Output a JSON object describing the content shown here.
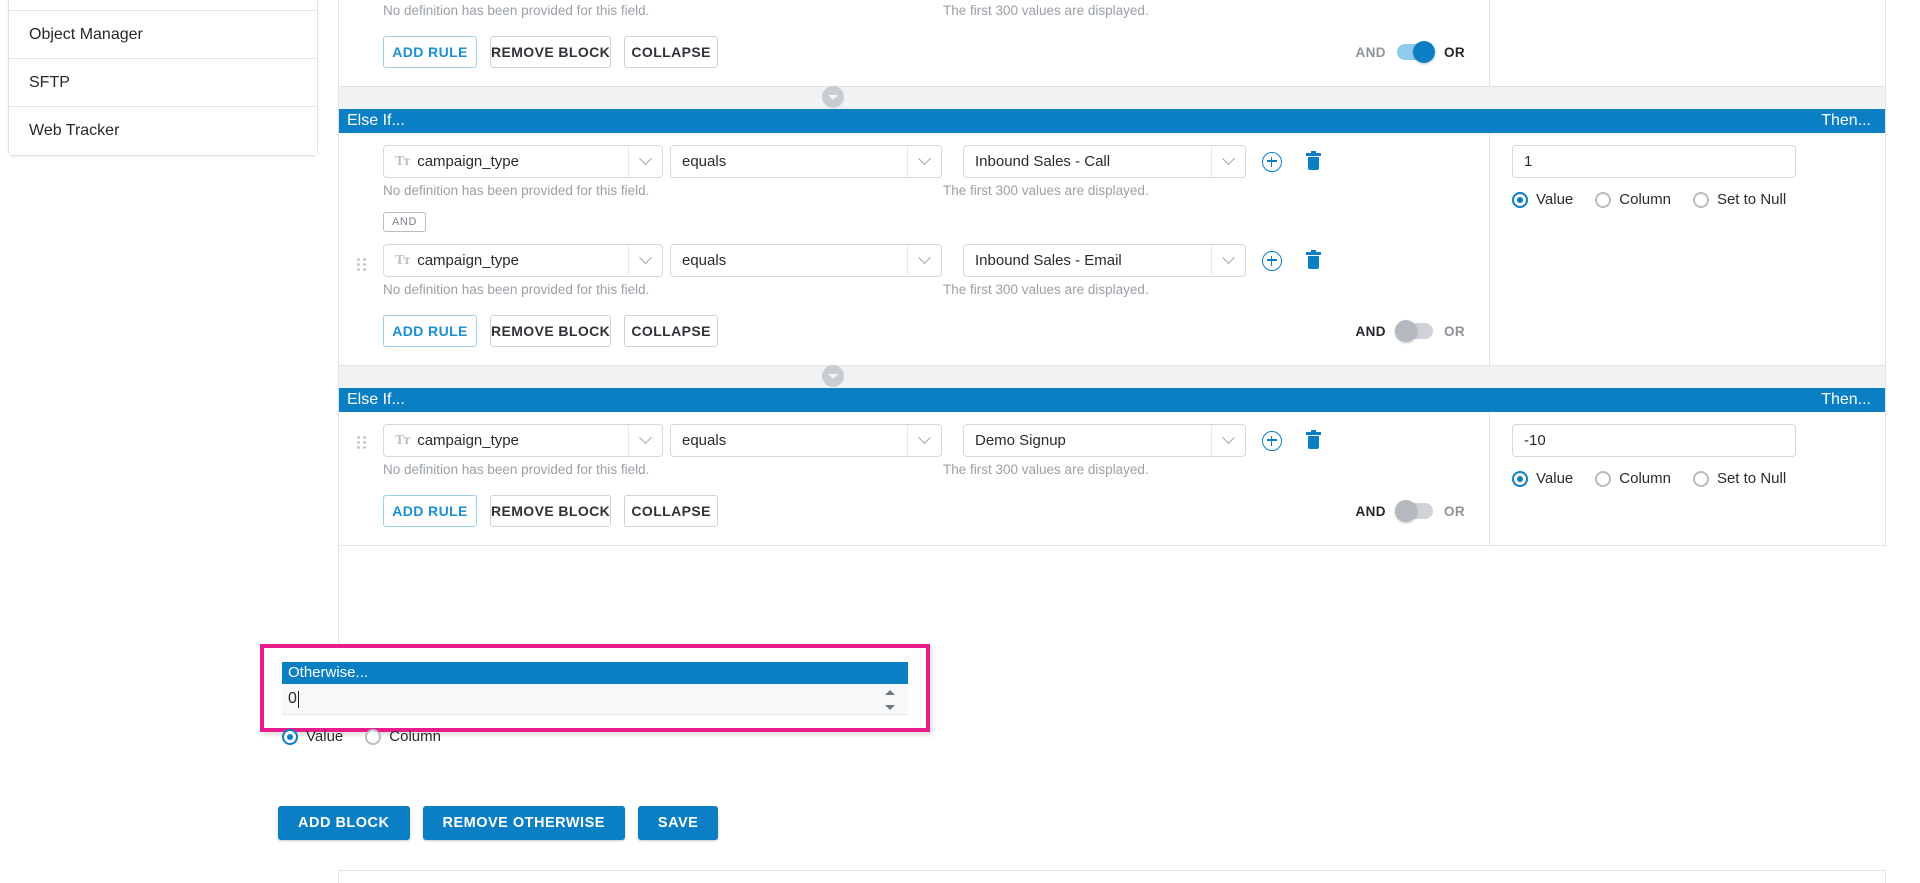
{
  "sidebar": {
    "items": [
      {
        "label": "Object Manager",
        "name": "sidebar-item-object-manager"
      },
      {
        "label": "SFTP",
        "name": "sidebar-item-sftp"
      },
      {
        "label": "Web Tracker",
        "name": "sidebar-item-web-tracker"
      }
    ]
  },
  "colors": {
    "accent": "#0b7fc4",
    "highlight": "#ec1b8b",
    "toggle_on": "#8ecbec",
    "toggle_off": "#cfd3d7"
  },
  "hints": {
    "field_definition": "No definition has been provided for this field.",
    "values_displayed": "The first 300 values are displayed."
  },
  "labels": {
    "else_if": "Else If...",
    "then": "Then...",
    "otherwise": "Otherwise...",
    "and_badge": "AND",
    "and": "AND",
    "or": "OR",
    "add_rule": "ADD RULE",
    "remove_block": "REMOVE BLOCK",
    "collapse": "COLLAPSE",
    "value": "Value",
    "column": "Column",
    "set_to_null": "Set to Null",
    "field_type_icon": "Tᴛ"
  },
  "blocks": [
    {
      "name": "block-partial-top",
      "header": null,
      "rules": [],
      "hint_field": "No definition has been provided for this field.",
      "hint_value": "The first 300 values are displayed.",
      "buttons": {
        "add_rule": "ADD RULE",
        "remove_block": "REMOVE BLOCK",
        "collapse": "COLLAPSE"
      },
      "logic_toggle": {
        "left": "AND",
        "right": "OR",
        "state": "or"
      }
    },
    {
      "name": "block-else-if-1",
      "header_left": "Else If...",
      "header_right": "Then...",
      "rules": [
        {
          "field": "campaign_type",
          "operator": "equals",
          "value": "Inbound Sales - Call"
        },
        {
          "field": "campaign_type",
          "operator": "equals",
          "value": "Inbound Sales - Email"
        }
      ],
      "inter_rule_badge": "AND",
      "then": {
        "input_value": "1",
        "options": [
          "Value",
          "Column",
          "Set to Null"
        ],
        "selected": "Value"
      },
      "buttons": {
        "add_rule": "ADD RULE",
        "remove_block": "REMOVE BLOCK",
        "collapse": "COLLAPSE"
      },
      "logic_toggle": {
        "left": "AND",
        "right": "OR",
        "state": "and"
      }
    },
    {
      "name": "block-else-if-2",
      "header_left": "Else If...",
      "header_right": "Then...",
      "rules": [
        {
          "field": "campaign_type",
          "operator": "equals",
          "value": "Demo Signup"
        }
      ],
      "then": {
        "input_value": "-10",
        "options": [
          "Value",
          "Column",
          "Set to Null"
        ],
        "selected": "Value"
      },
      "buttons": {
        "add_rule": "ADD RULE",
        "remove_block": "REMOVE BLOCK",
        "collapse": "COLLAPSE"
      },
      "logic_toggle": {
        "left": "AND",
        "right": "OR",
        "state": "and"
      }
    }
  ],
  "otherwise": {
    "header": "Otherwise...",
    "input_value": "0",
    "options": [
      "Value",
      "Column"
    ],
    "selected": "Value",
    "highlighted": true
  },
  "footer_buttons": {
    "add_block": "ADD BLOCK",
    "remove_otherwise": "REMOVE OTHERWISE",
    "save": "SAVE"
  }
}
